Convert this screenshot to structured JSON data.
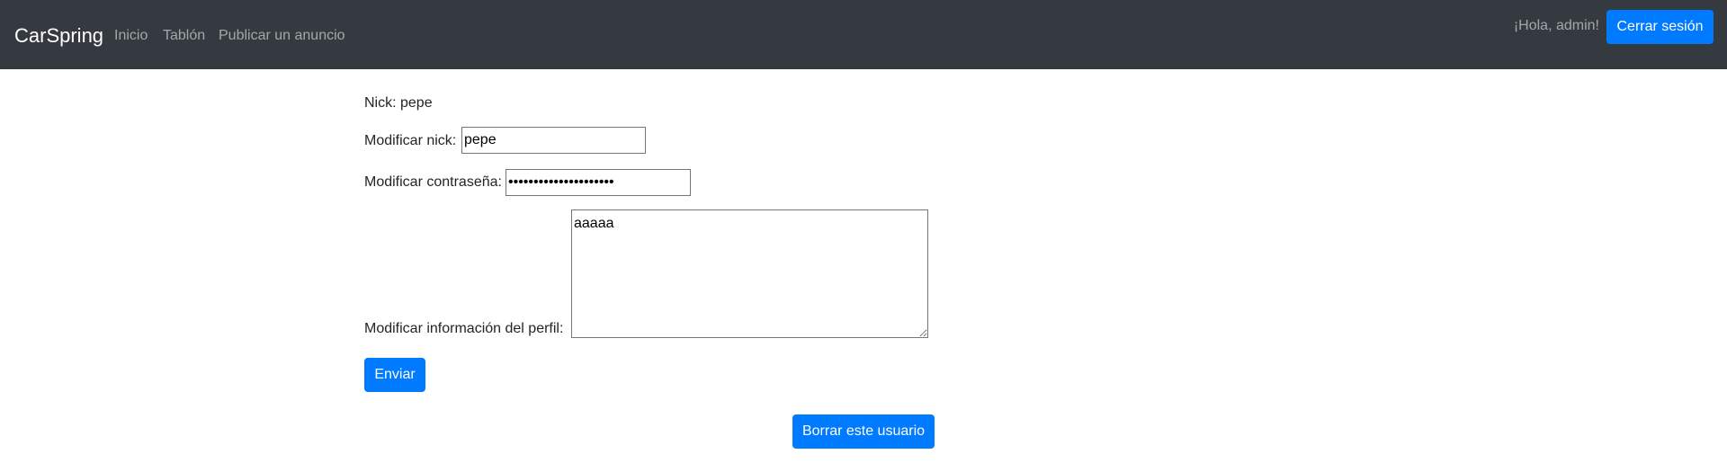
{
  "navbar": {
    "brand": "CarSpring",
    "links": [
      {
        "label": "Inicio"
      },
      {
        "label": "Tablón"
      },
      {
        "label": "Publicar un anuncio"
      }
    ],
    "greeting": "¡Hola, admin!",
    "logout_label": "Cerrar sesión",
    "background": "#343a40"
  },
  "profile": {
    "nick_line": "Nick: pepe",
    "modify_nick_label": "Modificar nick:",
    "modify_nick_value": "pepe",
    "modify_password_label": "Modificar contraseña:",
    "modify_password_value": "aaaaaaaaaaaaaaaaaaaaa",
    "modify_info_label": "Modificar información del perfil:",
    "modify_info_value": "aaaaa",
    "submit_label": "Enviar",
    "delete_label": "Borrar este usuario"
  },
  "colors": {
    "primary": "#007bff"
  }
}
